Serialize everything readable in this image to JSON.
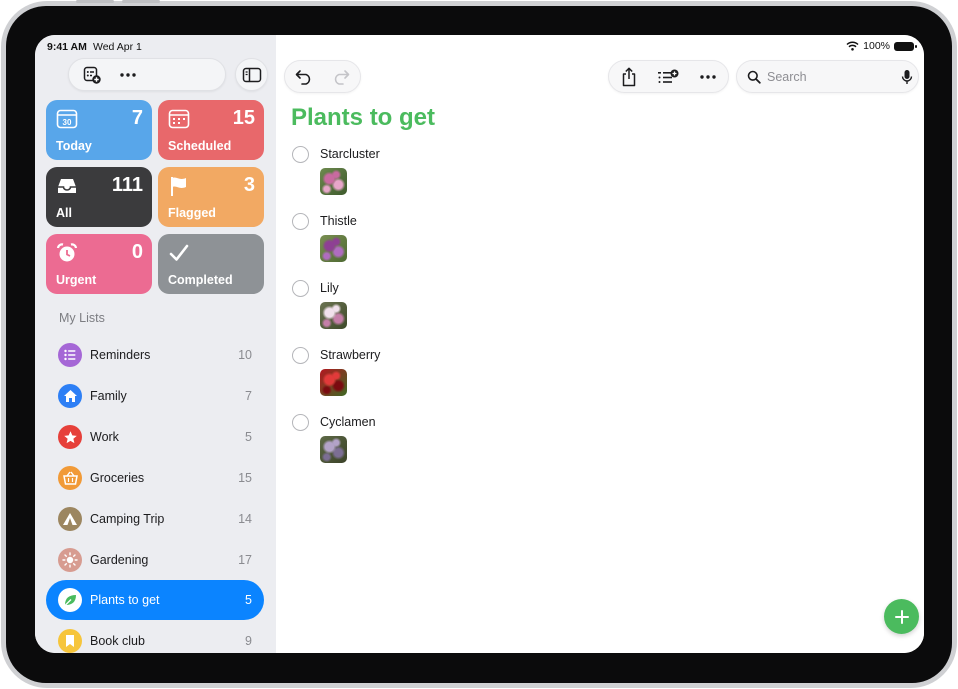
{
  "status": {
    "time": "9:41 AM",
    "date": "Wed Apr 1",
    "battery": "100%"
  },
  "smart_lists": {
    "today": {
      "label": "Today",
      "count": "7",
      "color": "#58a6ea",
      "icon": "calendar-today-icon",
      "day": "30"
    },
    "scheduled": {
      "label": "Scheduled",
      "count": "15",
      "color": "#e8686b",
      "icon": "calendar-grid-icon"
    },
    "all": {
      "label": "All",
      "count": "111",
      "color": "#3b3b3d",
      "icon": "tray-icon"
    },
    "flagged": {
      "label": "Flagged",
      "count": "3",
      "color": "#f2a963",
      "icon": "flag-icon"
    },
    "urgent": {
      "label": "Urgent",
      "count": "0",
      "color": "#ec6b92",
      "icon": "alarm-icon"
    },
    "completed": {
      "label": "Completed",
      "count": "",
      "color": "#8e9296",
      "icon": "checkmark-icon"
    }
  },
  "my_lists": {
    "heading": "My Lists",
    "items": [
      {
        "name": "Reminders",
        "count": "10",
        "color": "#a567d6",
        "icon": "list-bullet-icon"
      },
      {
        "name": "Family",
        "count": "7",
        "color": "#2d7ff5",
        "icon": "house-icon"
      },
      {
        "name": "Work",
        "count": "5",
        "color": "#e6403a",
        "icon": "star-icon"
      },
      {
        "name": "Groceries",
        "count": "15",
        "color": "#f19a37",
        "icon": "basket-icon"
      },
      {
        "name": "Camping Trip",
        "count": "14",
        "color": "#9c8660",
        "icon": "tent-icon"
      },
      {
        "name": "Gardening",
        "count": "17",
        "color": "#d79c91",
        "icon": "sun-icon"
      },
      {
        "name": "Plants to get",
        "count": "5",
        "color": "#4bbb5e",
        "icon": "leaf-icon",
        "selected": true
      },
      {
        "name": "Book club",
        "count": "9",
        "color": "#f6c53b",
        "icon": "bookmark-icon"
      }
    ]
  },
  "toolbar": {
    "search_placeholder": "Search"
  },
  "main": {
    "title": "Plants to get",
    "title_color": "#4bbb5e",
    "items": [
      {
        "name": "Starcluster",
        "thumb_colors": [
          "#6e8a4f",
          "#c96aa0",
          "#e7a6c9",
          "#3d5a2c"
        ]
      },
      {
        "name": "Thistle",
        "thumb_colors": [
          "#7a8f52",
          "#8e3f94",
          "#b06cc0",
          "#4f6a33"
        ]
      },
      {
        "name": "Lily",
        "thumb_colors": [
          "#6c7452",
          "#f1e1ec",
          "#c57fa9",
          "#3e4a2a"
        ]
      },
      {
        "name": "Strawberry",
        "thumb_colors": [
          "#b5161f",
          "#e13a3a",
          "#7a0b10",
          "#3c6a24"
        ]
      },
      {
        "name": "Cyclamen",
        "thumb_colors": [
          "#5e6a47",
          "#b3a3c8",
          "#7c6e94",
          "#3b4228"
        ]
      }
    ]
  }
}
